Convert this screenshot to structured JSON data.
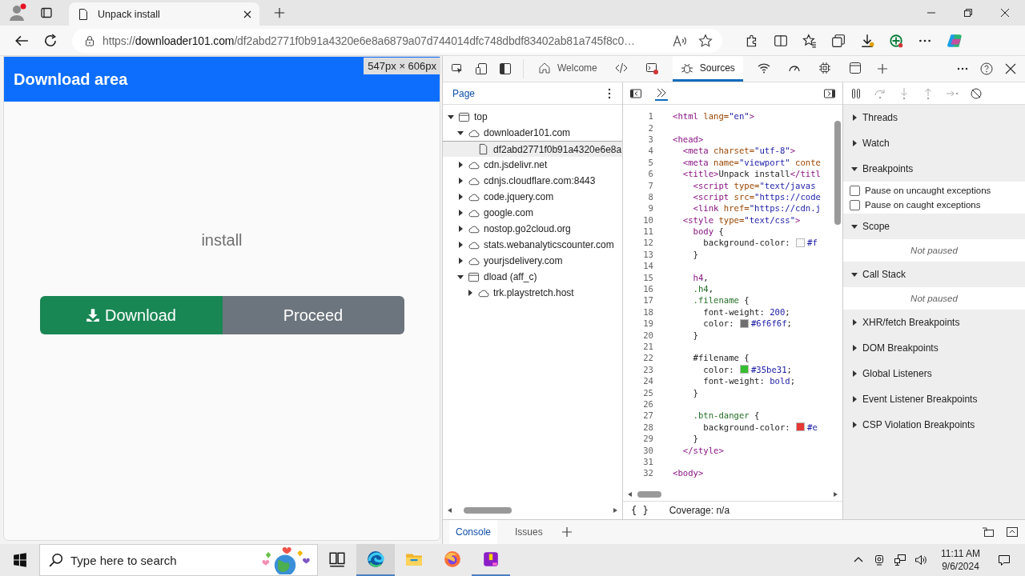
{
  "browser": {
    "tab": {
      "title": "Unpack install"
    },
    "url": {
      "scheme": "https://",
      "host": "downloader101.com",
      "path": "/df2abd2771f0b91a4320e6e8a6879a07d744014dfc748dbdf83402ab81a745f8c0…"
    }
  },
  "page": {
    "header": "Download area",
    "size_overlay": "547px × 606px",
    "filename": "install",
    "buttons": [
      {
        "label": "Download",
        "kind": "download"
      },
      {
        "label": "Proceed",
        "kind": "secondary"
      }
    ]
  },
  "devtools": {
    "tabs": [
      {
        "kind": "home",
        "label": "Welcome",
        "selected": false
      },
      {
        "kind": "code",
        "selected": false
      },
      {
        "kind": "console",
        "selected": false
      },
      {
        "kind": "bug",
        "label": "Sources",
        "selected": true
      },
      {
        "kind": "wifi",
        "selected": false
      },
      {
        "kind": "gauge",
        "selected": false
      },
      {
        "kind": "chip",
        "selected": false
      },
      {
        "kind": "window",
        "selected": false
      }
    ],
    "navigator": {
      "tab": "Page",
      "tree": [
        {
          "label": "top",
          "kind": "frame",
          "expanded": true,
          "selected": false,
          "children": [
            {
              "label": "downloader101.com",
              "kind": "cloud",
              "expanded": true,
              "selected": false,
              "children": [
                {
                  "label": "df2abd2771f0b91a4320e6e8a",
                  "kind": "file",
                  "selected": true
                }
              ]
            },
            {
              "label": "cdn.jsdelivr.net",
              "kind": "cloud",
              "expanded": false,
              "selected": false
            },
            {
              "label": "cdnjs.cloudflare.com:8443",
              "kind": "cloud",
              "expanded": false,
              "selected": false
            },
            {
              "label": "code.jquery.com",
              "kind": "cloud",
              "expanded": false,
              "selected": false
            },
            {
              "label": "google.com",
              "kind": "cloud",
              "expanded": false,
              "selected": false
            },
            {
              "label": "nostop.go2cloud.org",
              "kind": "cloud",
              "expanded": false,
              "selected": false
            },
            {
              "label": "stats.webanalyticscounter.com",
              "kind": "cloud",
              "expanded": false,
              "selected": false
            },
            {
              "label": "yourjsdelivery.com",
              "kind": "cloud",
              "expanded": false,
              "selected": false
            },
            {
              "label": "dload (aff_c)",
              "kind": "frame",
              "expanded": true,
              "selected": false,
              "children": [
                {
                  "label": "trk.playstretch.host",
                  "kind": "cloud",
                  "expanded": false,
                  "selected": false
                }
              ]
            }
          ]
        }
      ]
    },
    "editor": {
      "lines": [
        {
          "n": "1",
          "tokens": [
            {
              "t": "<html",
              "kind": "tag"
            },
            {
              "t": " lang=",
              "kind": "attr"
            },
            {
              "t": "\"en\"",
              "kind": "val"
            },
            {
              "t": ">",
              "kind": "tag"
            }
          ]
        },
        {
          "n": "2"
        },
        {
          "n": "3",
          "tokens": [
            {
              "t": "<head>",
              "kind": "tag"
            }
          ]
        },
        {
          "n": "4",
          "tokens": [
            {
              "t": "  <meta",
              "kind": "tag"
            },
            {
              "t": " charset=",
              "kind": "attr"
            },
            {
              "t": "\"utf-8\"",
              "kind": "val"
            },
            {
              "t": ">",
              "kind": "tag"
            }
          ]
        },
        {
          "n": "5",
          "tokens": [
            {
              "t": "  <meta",
              "kind": "tag"
            },
            {
              "t": " name=",
              "kind": "attr"
            },
            {
              "t": "\"viewport\"",
              "kind": "val"
            },
            {
              "t": " conte",
              "kind": "attr"
            }
          ]
        },
        {
          "n": "6",
          "tokens": [
            {
              "t": "  <title>",
              "kind": "tag"
            },
            {
              "t": "Unpack install",
              "kind": "plain"
            },
            {
              "t": "</titl",
              "kind": "tag"
            }
          ]
        },
        {
          "n": "7",
          "tokens": [
            {
              "t": "    <script",
              "kind": "tag"
            },
            {
              "t": " type=",
              "kind": "attr"
            },
            {
              "t": "\"text/javas",
              "kind": "val"
            }
          ]
        },
        {
          "n": "8",
          "tokens": [
            {
              "t": "    <script",
              "kind": "tag"
            },
            {
              "t": " src=",
              "kind": "attr"
            },
            {
              "t": "\"https://code",
              "kind": "val"
            }
          ]
        },
        {
          "n": "9",
          "tokens": [
            {
              "t": "    <link",
              "kind": "tag"
            },
            {
              "t": " href=",
              "kind": "attr"
            },
            {
              "t": "\"https://cdn.j",
              "kind": "val"
            }
          ]
        },
        {
          "n": "10",
          "tokens": [
            {
              "t": "  <style",
              "kind": "tag"
            },
            {
              "t": " type=",
              "kind": "attr"
            },
            {
              "t": "\"text/css\"",
              "kind": "val"
            },
            {
              "t": ">",
              "kind": "tag"
            }
          ]
        },
        {
          "n": "11",
          "tokens": [
            {
              "t": "    body",
              "kind": "tag"
            },
            {
              "t": " {",
              "kind": "plain"
            }
          ]
        },
        {
          "n": "12",
          "tokens": [
            {
              "t": "      background-color: ",
              "kind": "plain"
            },
            {
              "kind": "swatch",
              "color": "#fafafa"
            },
            {
              "t": "#f",
              "kind": "val"
            }
          ]
        },
        {
          "n": "13",
          "tokens": [
            {
              "t": "    }",
              "kind": "plain"
            }
          ]
        },
        {
          "n": "14"
        },
        {
          "n": "15",
          "tokens": [
            {
              "t": "    h4",
              "kind": "tag"
            },
            {
              "t": ",",
              "kind": "plain"
            }
          ]
        },
        {
          "n": "16",
          "tokens": [
            {
              "t": "    .h4",
              "kind": "cls"
            },
            {
              "t": ",",
              "kind": "plain"
            }
          ]
        },
        {
          "n": "17",
          "tokens": [
            {
              "t": "    .filename",
              "kind": "cls"
            },
            {
              "t": " {",
              "kind": "plain"
            }
          ]
        },
        {
          "n": "18",
          "tokens": [
            {
              "t": "      font-weight: ",
              "kind": "plain"
            },
            {
              "t": "200",
              "kind": "val"
            },
            {
              "t": ";",
              "kind": "plain"
            }
          ]
        },
        {
          "n": "19",
          "tokens": [
            {
              "t": "      color: ",
              "kind": "plain"
            },
            {
              "kind": "swatch",
              "color": "#6f6f6f"
            },
            {
              "t": "#6f6f6f",
              "kind": "val"
            },
            {
              "t": ";",
              "kind": "plain"
            }
          ]
        },
        {
          "n": "20",
          "tokens": [
            {
              "t": "    }",
              "kind": "plain"
            }
          ]
        },
        {
          "n": "21"
        },
        {
          "n": "22",
          "tokens": [
            {
              "t": "    #filename {",
              "kind": "plain"
            }
          ]
        },
        {
          "n": "23",
          "tokens": [
            {
              "t": "      color: ",
              "kind": "plain"
            },
            {
              "kind": "swatch",
              "color": "#35be31"
            },
            {
              "t": "#35be31",
              "kind": "val"
            },
            {
              "t": ";",
              "kind": "plain"
            }
          ]
        },
        {
          "n": "24",
          "tokens": [
            {
              "t": "      font-weight: ",
              "kind": "plain"
            },
            {
              "t": "bold",
              "kind": "val"
            },
            {
              "t": ";",
              "kind": "plain"
            }
          ]
        },
        {
          "n": "25",
          "tokens": [
            {
              "t": "    }",
              "kind": "plain"
            }
          ]
        },
        {
          "n": "26"
        },
        {
          "n": "27",
          "tokens": [
            {
              "t": "    .btn-danger",
              "kind": "cls"
            },
            {
              "t": " {",
              "kind": "plain"
            }
          ]
        },
        {
          "n": "28",
          "tokens": [
            {
              "t": "      background-color: ",
              "kind": "plain"
            },
            {
              "kind": "swatch",
              "color": "#e53935"
            },
            {
              "t": "#e",
              "kind": "val"
            }
          ]
        },
        {
          "n": "29",
          "tokens": [
            {
              "t": "    }",
              "kind": "plain"
            }
          ]
        },
        {
          "n": "30",
          "tokens": [
            {
              "t": "  </style>",
              "kind": "tag"
            }
          ]
        },
        {
          "n": "31"
        },
        {
          "n": "32",
          "tokens": [
            {
              "t": "<body>",
              "kind": "tag"
            }
          ]
        }
      ],
      "format_button": "{ }",
      "status": "Coverage: n/a"
    },
    "sidebar": {
      "sections": [
        {
          "title": "Threads",
          "expanded": false
        },
        {
          "title": "Watch",
          "expanded": false
        },
        {
          "title": "Breakpoints",
          "expanded": true,
          "checkboxes": [
            {
              "label": "Pause on uncaught exceptions",
              "checked": false
            },
            {
              "label": "Pause on caught exceptions",
              "checked": false
            }
          ]
        },
        {
          "title": "Scope",
          "expanded": true,
          "note": "Not paused"
        },
        {
          "title": "Call Stack",
          "expanded": true,
          "note": "Not paused"
        },
        {
          "title": "XHR/fetch Breakpoints",
          "expanded": false
        },
        {
          "title": "DOM Breakpoints",
          "expanded": false
        },
        {
          "title": "Global Listeners",
          "expanded": false
        },
        {
          "title": "Event Listener Breakpoints",
          "expanded": false
        },
        {
          "title": "CSP Violation Breakpoints",
          "expanded": false
        }
      ]
    },
    "drawer": {
      "tabs": [
        {
          "label": "Console",
          "selected": true
        },
        {
          "label": "Issues",
          "selected": false
        }
      ]
    }
  },
  "taskbar": {
    "search_placeholder": "Type here to search",
    "apps": [
      {
        "kind": "taskview",
        "selected": false,
        "running": false
      },
      {
        "kind": "edge",
        "selected": true,
        "running": true
      },
      {
        "kind": "explorer",
        "selected": false,
        "running": false
      },
      {
        "kind": "firefox",
        "selected": false,
        "running": false
      },
      {
        "kind": "archiver",
        "selected": false,
        "running": true
      }
    ],
    "time": "11:11 AM",
    "date": "9/6/2024"
  }
}
